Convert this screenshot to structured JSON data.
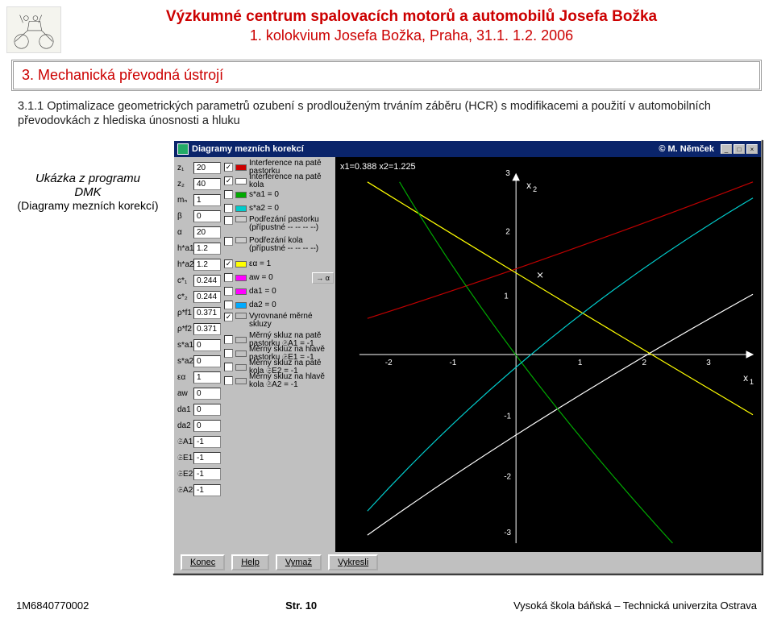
{
  "header": {
    "title": "Výzkumné centrum spalovacích motorů a automobilů Josefa Božka",
    "subtitle": "1. kolokvium Josefa Božka, Praha, 31.1.  1.2. 2006"
  },
  "section": {
    "number_title": "3. Mechanická převodná ústrojí"
  },
  "body": {
    "text": "3.1.1 Optimalizace geometrických parametrů ozubení s prodlouženým trváním záběru (HCR) s modifikacemi a použití v automobilních převodovkách z hlediska únosnosti a hluku"
  },
  "caption": {
    "line1": "Ukázka z programu",
    "line2": "DMK",
    "line3": "(Diagramy mezních korekcí)"
  },
  "app": {
    "title": "Diagramy mezních korekcí",
    "author": "© M. Němček",
    "minimize": "_",
    "maximize": "□",
    "close": "×",
    "params": [
      {
        "label": "z₁",
        "value": "20"
      },
      {
        "label": "z₂",
        "value": "40"
      },
      {
        "label": "mₙ",
        "value": "1"
      },
      {
        "label": "β",
        "value": "0"
      },
      {
        "label": "α",
        "value": "20"
      },
      {
        "label": "h*a1",
        "value": "1.2"
      },
      {
        "label": "h*a2",
        "value": "1.2"
      },
      {
        "label": "c*₁",
        "value": "0.244"
      },
      {
        "label": "c*₂",
        "value": "0.244"
      },
      {
        "label": "ρ*f1",
        "value": "0.371"
      },
      {
        "label": "ρ*f2",
        "value": "0.371"
      },
      {
        "label": "s*a1",
        "value": "0"
      },
      {
        "label": "s*a2",
        "value": "0"
      },
      {
        "label": "εα",
        "value": "1"
      },
      {
        "label": "aw",
        "value": "0"
      },
      {
        "label": "da1",
        "value": "0"
      },
      {
        "label": "da2",
        "value": "0"
      },
      {
        "label": "𝔖A1",
        "value": "-1"
      },
      {
        "label": "𝔖E1",
        "value": "-1"
      },
      {
        "label": "𝔖E2",
        "value": "-1"
      },
      {
        "label": "𝔖A2",
        "value": "-1"
      }
    ],
    "checks": [
      {
        "on": true,
        "color": "#c00",
        "label": "Interference na patě pastorku"
      },
      {
        "on": true,
        "color": "#fff",
        "label": "Interference na patě kola"
      },
      {
        "on": false,
        "color": "#0a0",
        "label": "s*a1 = 0"
      },
      {
        "on": false,
        "color": "#0cc",
        "label": "s*a2 = 0"
      },
      {
        "on": false,
        "color": "#ccc",
        "label": "Podřezání pastorku (přípustné -- -- -- --)"
      },
      {
        "on": false,
        "color": "#ccc",
        "label": "Podřezání kola (přípustné -- -- -- --)"
      },
      {
        "on": true,
        "color": "#ff0",
        "label": "εα = 1"
      },
      {
        "on": false,
        "color": "#f0f",
        "label": "aw = 0"
      },
      {
        "on": false,
        "color": "#f0f",
        "label": "da1 = 0"
      },
      {
        "on": false,
        "color": "#0af",
        "label": "da2 = 0"
      },
      {
        "on": true,
        "color": "#c0c0c0",
        "label": "Vyrovnané měrné skluzy"
      },
      {
        "on": false,
        "color": "#c0c0c0",
        "label": "Měrný skluz na patě pastorku 𝔖A1 = -1"
      },
      {
        "on": false,
        "color": "#c0c0c0",
        "label": "Měrný skluz na hlavě pastorku 𝔖E1 = -1"
      },
      {
        "on": false,
        "color": "#c0c0c0",
        "label": "Měrný skluz na patě kola 𝔖E2 = -1"
      },
      {
        "on": false,
        "color": "#c0c0c0",
        "label": "Měrný skluz na hlavě kola 𝔖A2 = -1"
      }
    ],
    "alpha_btn": "→ α",
    "plot_info": "x1=0.388 x2=1.225",
    "axis_x_label": "x₁",
    "axis_y_label_top": "x₂",
    "buttons": {
      "konec": "Konec",
      "help": "Help",
      "vymaz": "Vymaž",
      "vykresli": "Vykresli"
    }
  },
  "footer": {
    "left": "1M6840770002",
    "center": "Str. 10",
    "right": "Vysoká škola báňská – Technická univerzita Ostrava"
  },
  "chart_data": {
    "type": "line",
    "title": "Diagramy mezních korekcí",
    "xlabel": "x₁",
    "ylabel": "x₂",
    "xlim": [
      -2,
      3
    ],
    "ylim": [
      -3,
      3
    ],
    "info_point": {
      "x1": 0.388,
      "x2": 1.225
    },
    "series": [
      {
        "name": "Interference na patě pastorku",
        "color": "#c00000",
        "x": [
          -2,
          -1,
          0,
          1,
          2,
          3
        ],
        "y": [
          0.8,
          1.2,
          1.6,
          2.0,
          2.4,
          2.8
        ]
      },
      {
        "name": "Interference na patě kola",
        "color": "#ffffff",
        "x": [
          -2,
          -1,
          0,
          1,
          2,
          3
        ],
        "y": [
          -3.0,
          -2.2,
          -1.4,
          -0.6,
          0.2,
          1.0
        ]
      },
      {
        "name": "εα = 1",
        "color": "#ffff00",
        "x": [
          -2,
          -1,
          0,
          1,
          2,
          3
        ],
        "y": [
          3.0,
          2.2,
          1.4,
          0.6,
          -0.2,
          -1.0
        ]
      },
      {
        "name": "s*a1 = 0",
        "color": "#00aa00",
        "x": [
          -2,
          0,
          2,
          3
        ],
        "y": [
          3.0,
          0.0,
          -2.4,
          -3.0
        ]
      },
      {
        "name": "s*a2 = 0",
        "color": "#00cccc",
        "x": [
          -2,
          -1,
          0,
          1,
          2,
          3
        ],
        "y": [
          -2.6,
          -1.0,
          0.2,
          1.2,
          2.0,
          2.6
        ]
      }
    ]
  }
}
